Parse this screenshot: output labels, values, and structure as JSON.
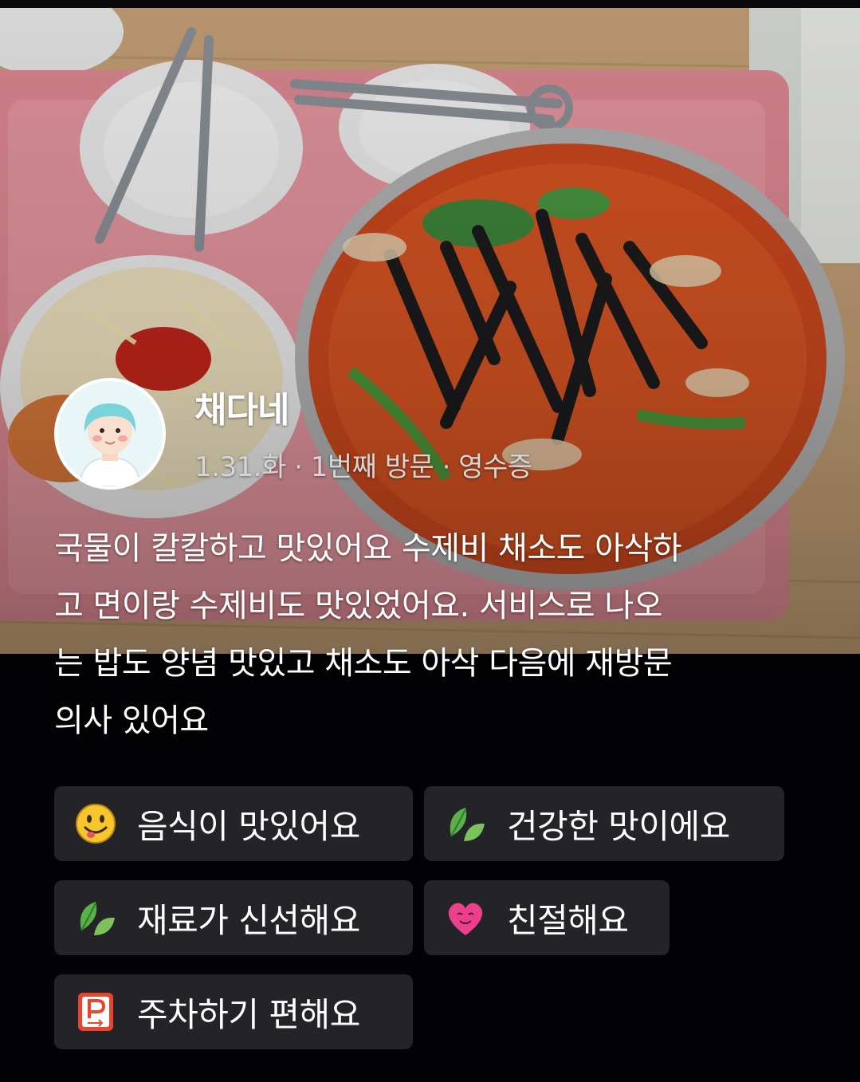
{
  "review": {
    "author": "채다네",
    "meta": "1.31.화 · 1번째 방문 · 영수증",
    "text_lines": [
      "국물이 칼칼하고 맛있어요 수제비 채소도 아삭하",
      "고 면이랑 수제비도 맛있었어요. 서비스로 나오",
      "는 밥도 양념 맛있고 채소도 아삭 다음에 재방문",
      "의사 있어요"
    ]
  },
  "tags": [
    {
      "label": "음식이 맛있어요",
      "icon": "smiley-face-icon"
    },
    {
      "label": "건강한 맛이에요",
      "icon": "leaf-icon"
    },
    {
      "label": "재료가 신선해요",
      "icon": "leaf-icon"
    },
    {
      "label": "친절해요",
      "icon": "heart-face-icon"
    },
    {
      "label": "주차하기 편해요",
      "icon": "parking-sign-icon"
    }
  ],
  "colors": {
    "background": "#030305",
    "tag_background": "#242428",
    "meta_text": "#d6d6d6"
  }
}
